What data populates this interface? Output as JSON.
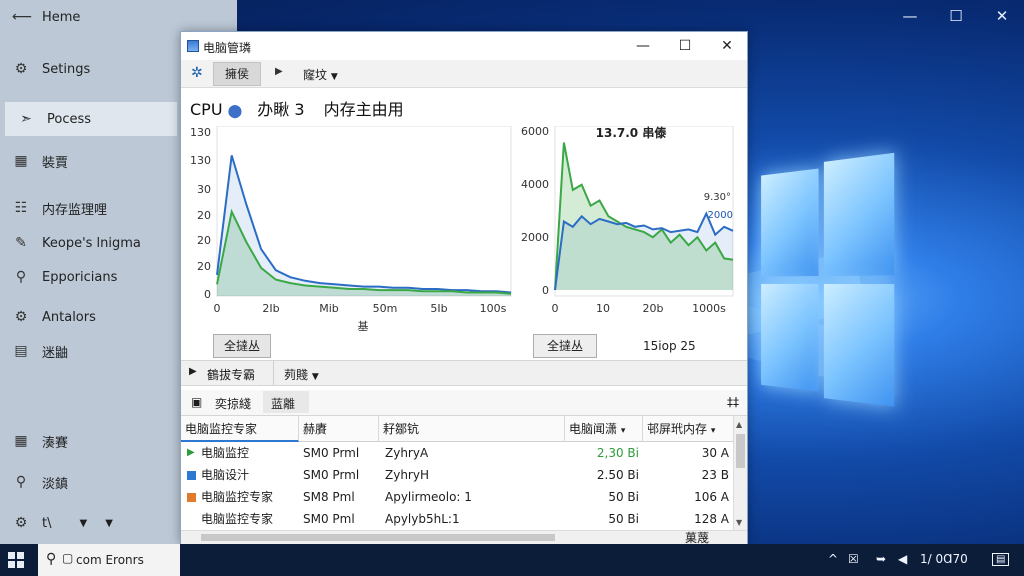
{
  "desktop": {
    "controls": {
      "minimize": "—",
      "maximize": "☐",
      "close": "✕"
    }
  },
  "settings": {
    "home": "Heme",
    "items": [
      {
        "label": "Setings",
        "icon": "gear-icon",
        "glyph": "⚙"
      },
      {
        "label": "Pocess",
        "icon": "process-icon",
        "glyph": "➣",
        "selected": true
      },
      {
        "label": "裝賈",
        "icon": "grid-icon",
        "glyph": "▦"
      },
      {
        "label": "内存监理哩",
        "icon": "list-icon",
        "glyph": "☷"
      },
      {
        "label": "Keope's lnigma",
        "icon": "pen-icon",
        "glyph": "✎"
      },
      {
        "label": "Epporicians",
        "icon": "bulb-icon",
        "glyph": "⚲"
      },
      {
        "label": "Antalors",
        "icon": "cog-icon",
        "glyph": "⚙"
      },
      {
        "label": "迷鼬",
        "icon": "panel-icon",
        "glyph": "▤"
      },
      {
        "label": "湊賽",
        "icon": "apps-icon",
        "glyph": "▦"
      },
      {
        "label": "淡鎮",
        "icon": "mic-icon",
        "glyph": "⚲"
      },
      {
        "label": "t\\",
        "icon": "gear-small-icon",
        "glyph": "⚙"
      }
    ]
  },
  "window": {
    "title": "电脑管璘",
    "controls": {
      "minimize": "—",
      "maximize": "☐",
      "close": "✕"
    },
    "toolbar": {
      "active_tab": "擁侯",
      "dropdown": "窿坟"
    },
    "headline": {
      "cpu": "CPU",
      "middle": "办瞅 3",
      "right": "内存主由用"
    },
    "chart_left": {
      "y_ticks": [
        "130",
        "130",
        "30",
        "20",
        "20",
        "20",
        "0"
      ],
      "x_ticks": [
        "0",
        "2Ib",
        "Mib",
        "50m",
        "5Ib",
        "100s"
      ],
      "x_label": "基"
    },
    "chart_right": {
      "title": "13.7.0 串傣",
      "y_ticks": [
        "6000",
        "4000",
        "2000",
        "0"
      ],
      "x_ticks": [
        "0",
        "10",
        "20b",
        "1000s"
      ],
      "annot1": "9.30°",
      "annot2": "2000"
    },
    "left_button": "全撻丛",
    "right_button": "全撻丛",
    "right_label": "15iop 25",
    "subbar": {
      "play_label": "鶴拔专霸",
      "dropdown": "茢賤"
    },
    "subbar2": {
      "tab1": "奕掠綫",
      "tab2": "蓝離",
      "right": "‡‡"
    },
    "table": {
      "headers": [
        "电脑监控专家",
        "赫賡",
        "耔鄒钪",
        "电脑闻潇",
        "邨屏玳内存"
      ],
      "rows": [
        {
          "name": "电脑监控",
          "c2": "SM0 Prml",
          "c3": "ZyhryA",
          "c4": "2,30 Bi",
          "c5": "30 A",
          "marker": "#2e9b3a",
          "marker_shape": "triangle"
        },
        {
          "name": "电脑设汁",
          "c2": "SM0 Prml",
          "c3": "ZyhryH",
          "c4": "2.50 Bi",
          "c5": "23 B",
          "marker": "#2d78d0",
          "marker_shape": "square"
        },
        {
          "name": "电脑监控专家",
          "c2": "SM8 Pml",
          "c3": "Apylirmeolo: 1",
          "c4": "50 Bi",
          "c5": "106 A",
          "marker": "#e07b2e",
          "marker_shape": "square"
        },
        {
          "name": "电脑监控专家",
          "c2": "SM0 Pml",
          "c3": "Apylyb5hL:1",
          "c4": "50 Bi",
          "c5": "128 A",
          "marker": "",
          "marker_shape": "none"
        }
      ]
    },
    "status_right": "菓蔑"
  },
  "taskbar": {
    "search_text": "com Eronrs",
    "time": "1/ 0Ɑ70",
    "tray_up": "^"
  },
  "chart_data": [
    {
      "type": "area",
      "x": [
        0,
        1,
        2,
        3,
        4,
        5,
        6,
        7,
        8,
        9,
        10,
        11,
        12,
        13,
        14,
        15,
        16,
        17,
        18,
        19,
        20
      ],
      "series": [
        {
          "values": [
            18,
            120,
            78,
            40,
            22,
            16,
            13,
            11,
            10,
            9,
            8,
            8,
            7,
            7,
            6,
            6,
            5,
            5,
            4,
            4,
            3
          ],
          "color": "#2b6cc4"
        },
        {
          "values": [
            10,
            72,
            46,
            24,
            14,
            11,
            9,
            8,
            7,
            6,
            6,
            5,
            5,
            5,
            4,
            4,
            4,
            3,
            3,
            3,
            2
          ],
          "color": "#3aa845"
        }
      ],
      "ylim": [
        0,
        140
      ],
      "grid": false
    },
    {
      "type": "area",
      "title": "13.7.0 串傣",
      "x": [
        0,
        1,
        2,
        3,
        4,
        5,
        6,
        7,
        8,
        9,
        10,
        11,
        12,
        13,
        14,
        15,
        16,
        17,
        18,
        19,
        20
      ],
      "series": [
        {
          "values": [
            0,
            5600,
            3800,
            4000,
            3200,
            3400,
            2800,
            2600,
            2400,
            2300,
            2200,
            2000,
            2300,
            1800,
            2100,
            1700,
            2000,
            1500,
            1800,
            1200,
            1150
          ],
          "color": "#3aa845"
        },
        {
          "values": [
            0,
            2600,
            2400,
            2800,
            2500,
            2700,
            2600,
            2500,
            2550,
            2400,
            2450,
            2300,
            2350,
            2200,
            2250,
            2300,
            2200,
            2900,
            2100,
            2400,
            2250
          ],
          "color": "#2b6cc4"
        }
      ],
      "ylim": [
        0,
        6000
      ],
      "grid": false
    }
  ]
}
